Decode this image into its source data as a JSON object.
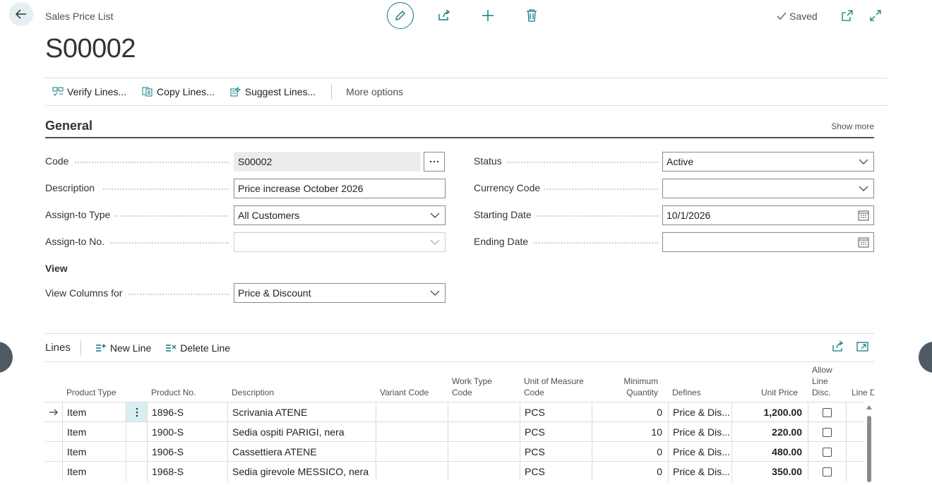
{
  "header": {
    "breadcrumb": "Sales Price List",
    "title": "S00002",
    "saved": "Saved"
  },
  "actions": [
    {
      "label": "Verify Lines...",
      "icon": "verify-lines-icon"
    },
    {
      "label": "Copy Lines...",
      "icon": "copy-lines-icon"
    },
    {
      "label": "Suggest Lines...",
      "icon": "suggest-lines-icon"
    },
    {
      "label": "More options"
    }
  ],
  "general": {
    "title": "General",
    "show_more": "Show more",
    "left_fields": [
      {
        "label": "Code",
        "value": "S00002"
      },
      {
        "label": "Description",
        "value": "Price increase October 2026"
      },
      {
        "label": "Assign-to Type",
        "value": "All Customers"
      },
      {
        "label": "Assign-to No.",
        "value": ""
      }
    ],
    "right_fields": [
      {
        "label": "Status",
        "value": "Active"
      },
      {
        "label": "Currency Code",
        "value": ""
      },
      {
        "label": "Starting Date",
        "value": "10/1/2026"
      },
      {
        "label": "Ending Date",
        "value": ""
      }
    ],
    "view_title": "View",
    "view_field": {
      "label": "View Columns for",
      "value": "Price & Discount"
    }
  },
  "lines": {
    "title": "Lines",
    "new_line": "New Line",
    "delete_line": "Delete Line",
    "columns": {
      "product_type": "Product Type",
      "product_no": "Product No.",
      "description": "Description",
      "variant_code": "Variant Code",
      "work_type_code": "Work Type Code",
      "uom": "Unit of Measure Code",
      "min_qty": "Minimum Quantity",
      "defines": "Defines",
      "unit_price": "Unit Price",
      "allow_line_disc": "Allow Line Disc.",
      "line_disc": "Line D"
    },
    "rows": [
      {
        "type": "Item",
        "no": "1896-S",
        "desc": "Scrivania ATENE",
        "variant": "",
        "work": "",
        "uom": "PCS",
        "qty": "0",
        "defines": "Price & Dis...",
        "price": "1,200.00",
        "allow": false
      },
      {
        "type": "Item",
        "no": "1900-S",
        "desc": "Sedia ospiti PARIGI, nera",
        "variant": "",
        "work": "",
        "uom": "PCS",
        "qty": "10",
        "defines": "Price & Dis...",
        "price": "220.00",
        "allow": false
      },
      {
        "type": "Item",
        "no": "1906-S",
        "desc": "Cassettiera ATENE",
        "variant": "",
        "work": "",
        "uom": "PCS",
        "qty": "0",
        "defines": "Price & Dis...",
        "price": "480.00",
        "allow": false
      },
      {
        "type": "Item",
        "no": "1968-S",
        "desc": "Sedia girevole MESSICO, nera",
        "variant": "",
        "work": "",
        "uom": "PCS",
        "qty": "0",
        "defines": "Price & Dis...",
        "price": "350.00",
        "allow": false
      }
    ]
  },
  "colors": {
    "accent": "#0f7c80",
    "text": "#212121",
    "border": "#8a8a8a"
  }
}
